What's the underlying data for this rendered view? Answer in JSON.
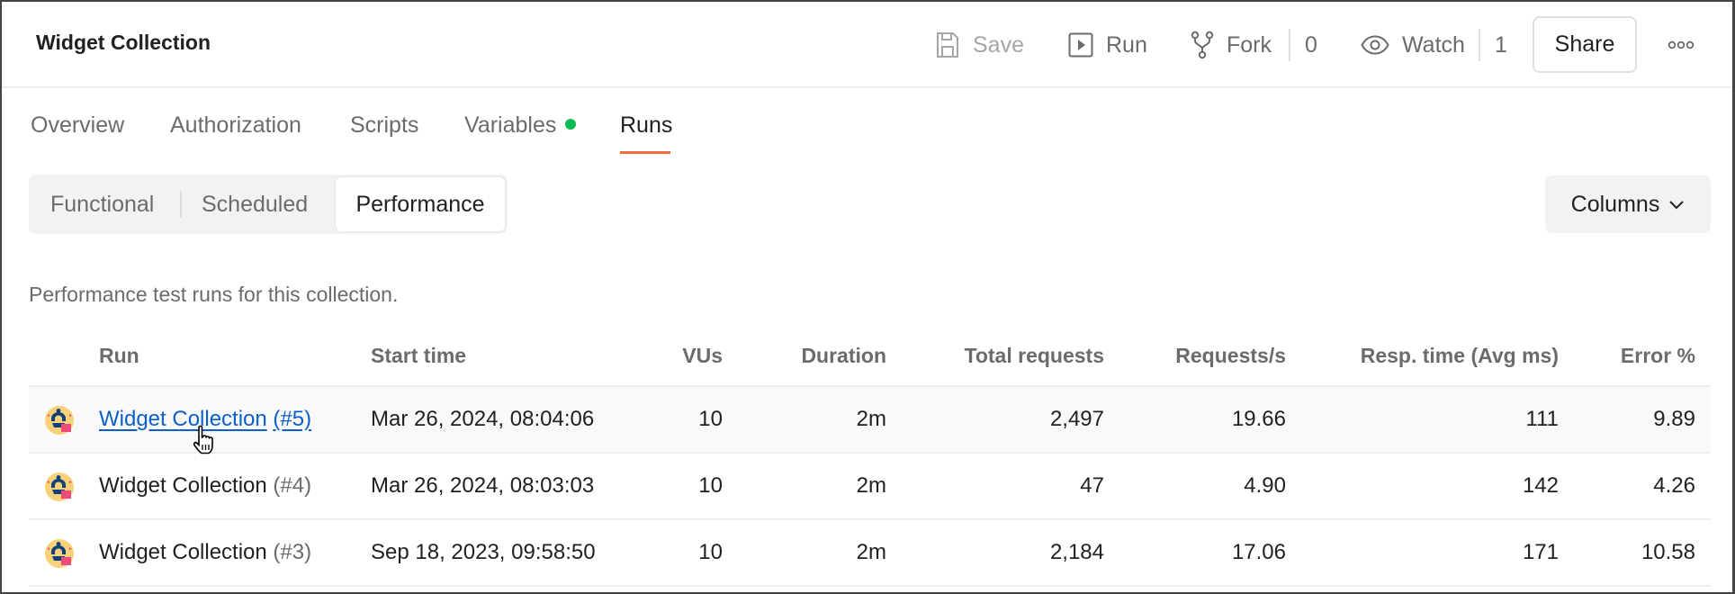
{
  "header": {
    "title": "Widget Collection",
    "save_label": "Save",
    "run_label": "Run",
    "fork_label": "Fork",
    "fork_count": "0",
    "watch_label": "Watch",
    "watch_count": "1",
    "share_label": "Share",
    "more_icon": "ellipsis-icon"
  },
  "tabs": [
    {
      "label": "Overview",
      "active": false
    },
    {
      "label": "Authorization",
      "active": false
    },
    {
      "label": "Scripts",
      "active": false
    },
    {
      "label": "Variables",
      "active": false,
      "indicator": "green-dot"
    },
    {
      "label": "Runs",
      "active": true
    }
  ],
  "run_types": [
    {
      "label": "Functional",
      "active": false
    },
    {
      "label": "Scheduled",
      "active": false
    },
    {
      "label": "Performance",
      "active": true
    }
  ],
  "columns_button": "Columns",
  "description": "Performance test runs for this collection.",
  "table": {
    "headers": [
      "Run",
      "Start time",
      "VUs",
      "Duration",
      "Total requests",
      "Requests/s",
      "Resp. time (Avg ms)",
      "Error %"
    ],
    "rows": [
      {
        "name": "Widget Collection",
        "number": "(#5)",
        "start": "Mar 26, 2024, 08:04:06",
        "vus": "10",
        "duration": "2m",
        "total": "2,497",
        "rps": "19.66",
        "resp": "111",
        "error": "9.89",
        "hovered": true
      },
      {
        "name": "Widget Collection",
        "number": "(#4)",
        "start": "Mar 26, 2024, 08:03:03",
        "vus": "10",
        "duration": "2m",
        "total": "47",
        "rps": "4.90",
        "resp": "142",
        "error": "4.26",
        "hovered": false
      },
      {
        "name": "Widget Collection",
        "number": "(#3)",
        "start": "Sep 18, 2023, 09:58:50",
        "vus": "10",
        "duration": "2m",
        "total": "2,184",
        "rps": "17.06",
        "resp": "171",
        "error": "10.58",
        "hovered": false
      }
    ]
  },
  "colors": {
    "accent_underline": "#f26b3a",
    "variables_dot": "#0cbb52",
    "link": "#0b5fc9"
  }
}
